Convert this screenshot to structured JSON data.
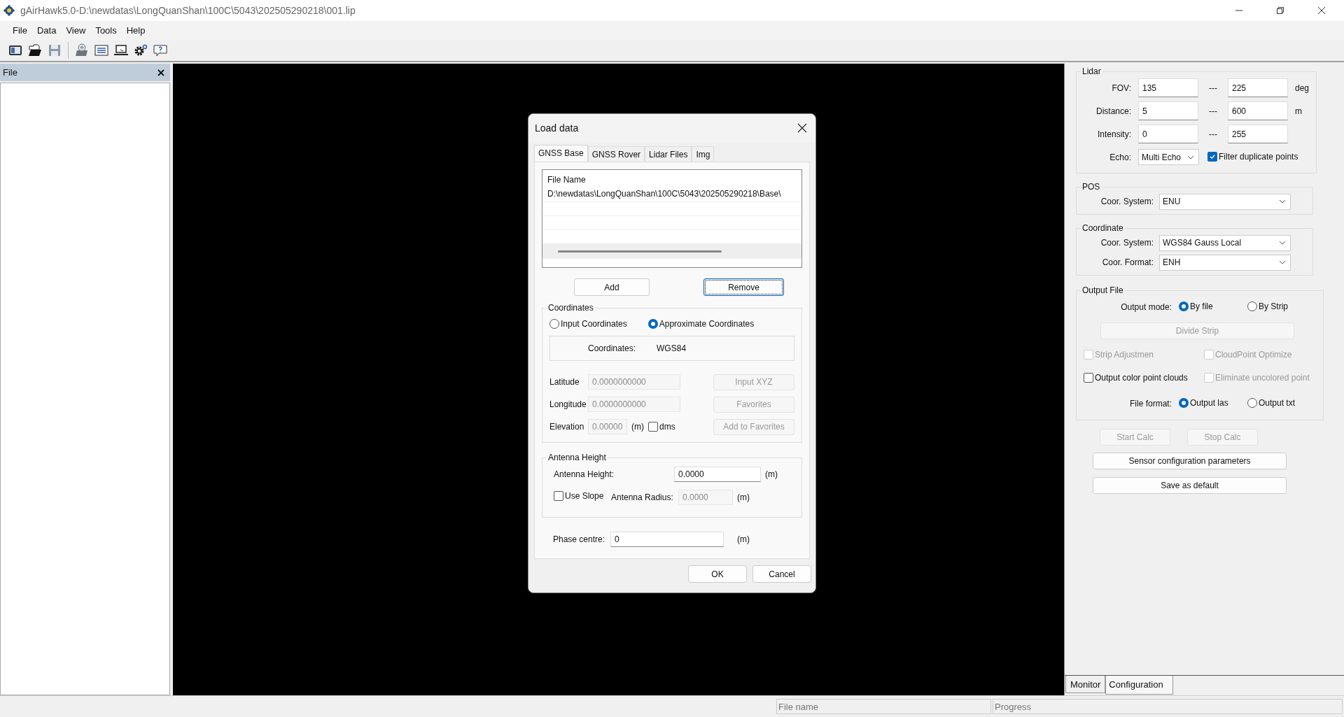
{
  "window": {
    "title": "gAirHawk5.0-D:\\newdatas\\LongQuanShan\\100C\\5043\\202505290218\\001.lip"
  },
  "menu": [
    "File",
    "Data",
    "View",
    "Tools",
    "Help"
  ],
  "file_panel": {
    "title": "File"
  },
  "dialog": {
    "title": "Load data",
    "tabs": [
      {
        "label": "GNSS Base",
        "selected": true
      },
      {
        "label": "GNSS Rover",
        "selected": false
      },
      {
        "label": "Lidar Files",
        "selected": false
      },
      {
        "label": "Img",
        "selected": false
      }
    ],
    "file_list": {
      "column": "File Name",
      "rows": [
        "D:\\newdatas\\LongQuanShan\\100C\\5043\\202505290218\\Base\\"
      ]
    },
    "list_buttons": [
      {
        "label": "Add",
        "focused": false
      },
      {
        "label": "Remove",
        "focused": true
      }
    ],
    "coordinates": {
      "legend": "Coordinates",
      "modes": [
        {
          "label": "Input Coordinates",
          "selected": false
        },
        {
          "label": "Approximate Coordinates",
          "selected": true
        }
      ],
      "system_label": "Coordinates:",
      "system_value": "WGS84",
      "fields": [
        {
          "label": "Latitude",
          "value": "0.0000000000",
          "button": "Input XYZ",
          "disabled": true
        },
        {
          "label": "Longitude",
          "value": "0.0000000000",
          "button": "Favorites",
          "disabled": true
        },
        {
          "label": "Elevation",
          "value": "0.00000",
          "unit": "(m)",
          "button": "Add to Favorites",
          "disabled": true
        }
      ],
      "dms": {
        "label": "dms",
        "checked": false
      }
    },
    "antenna": {
      "legend": "Antenna Height",
      "height_label": "Antenna Height:",
      "height_value": "0.0000",
      "height_unit": "(m)",
      "slope": {
        "label": "Use Slope",
        "checked": false
      },
      "radius_label": "Antenna Radius:",
      "radius_value": "0.0000",
      "radius_unit": "(m)",
      "radius_disabled": true
    },
    "phase": {
      "label": "Phase centre:",
      "value": "0",
      "unit": "(m)"
    },
    "buttons": [
      "OK",
      "Cancel"
    ]
  },
  "config": {
    "lidar": {
      "legend": "Lidar",
      "ranges": [
        {
          "label": "FOV:",
          "from": "135",
          "sep": "---",
          "to": "225",
          "unit": "deg"
        },
        {
          "label": "Distance:",
          "from": "5",
          "sep": "---",
          "to": "600",
          "unit": "m"
        },
        {
          "label": "Intensity:",
          "from": "0",
          "sep": "---",
          "to": "255"
        }
      ],
      "echo_label": "Echo:",
      "echo_value": "Multi Echo",
      "filter": {
        "label": "Filter duplicate points",
        "checked": true
      }
    },
    "pos": {
      "legend": "POS",
      "rows": [
        {
          "label": "Coor. System:",
          "value": "ENU"
        }
      ]
    },
    "coordinate": {
      "legend": "Coordinate",
      "rows": [
        {
          "label": "Coor. System:",
          "value": "WGS84 Gauss Local"
        },
        {
          "label": "Coor. Format:",
          "value": "ENH"
        }
      ]
    },
    "output": {
      "legend": "Output File",
      "mode_label": "Output mode:",
      "modes": [
        {
          "label": "By file",
          "selected": true
        },
        {
          "label": "By Strip",
          "selected": false
        }
      ],
      "divide": {
        "label": "Divide Strip",
        "disabled": true
      },
      "options": [
        {
          "label": "Strip Adjustmen",
          "checked": false,
          "disabled": true
        },
        {
          "label": "CloudPoint Optimize",
          "checked": false,
          "disabled": true
        },
        {
          "label": "Output color point clouds",
          "checked": false,
          "disabled": false
        },
        {
          "label": "Eliminate uncolored point",
          "checked": false,
          "disabled": true
        }
      ],
      "format_label": "File format:",
      "formats": [
        {
          "label": "Output las",
          "selected": true
        },
        {
          "label": "Output txt",
          "selected": false
        }
      ]
    },
    "actions": [
      {
        "label": "Start Calc",
        "disabled": true
      },
      {
        "label": "Stop Calc",
        "disabled": true
      }
    ],
    "buttons": [
      "Sensor configuration parameters",
      "Save as default"
    ]
  },
  "bottom_tabs": [
    {
      "label": "Monitor",
      "selected": false
    },
    {
      "label": "Configuration",
      "selected": true
    }
  ],
  "status_bar": [
    "File name",
    "Progress"
  ]
}
